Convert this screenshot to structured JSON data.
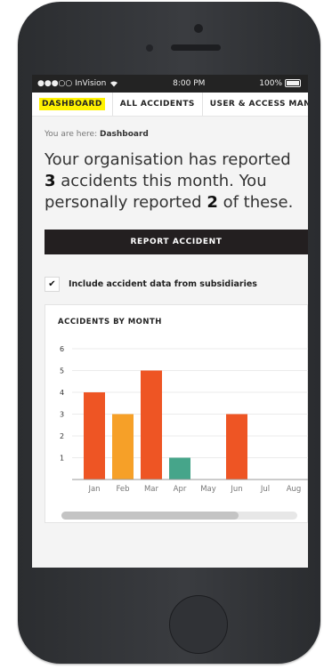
{
  "statusbar": {
    "carrier": "●●●○○ InVision",
    "wifi_icon": "wifi-icon",
    "time": "8:00 PM",
    "battery": "100%"
  },
  "nav": {
    "items": [
      {
        "label": "DASHBOARD",
        "active": true
      },
      {
        "label": "ALL ACCIDENTS",
        "active": false
      },
      {
        "label": "USER & ACCESS MANAG",
        "active": false
      }
    ]
  },
  "breadcrumb": {
    "prefix": "You are here:",
    "current": "Dashboard"
  },
  "headline": {
    "part1": "Your organisation has reported ",
    "count_org": "3",
    "part2": " accidents this month. You personally reported ",
    "count_user": "2",
    "part3": " of these."
  },
  "report_button": {
    "label": "REPORT ACCIDENT"
  },
  "subsidiaries": {
    "checked": true,
    "check_glyph": "✔",
    "label": "Include accident data from subsidiaries"
  },
  "chart_title": "ACCIDENTS BY MONTH",
  "chart_data": {
    "type": "bar",
    "title": "ACCIDENTS BY MONTH",
    "categories": [
      "Jan",
      "Feb",
      "Mar",
      "Apr",
      "May",
      "Jun",
      "Jul",
      "Aug"
    ],
    "values": [
      4,
      3,
      5,
      1,
      0,
      3,
      0,
      0
    ],
    "colors": [
      "#ee5524",
      "#f6a028",
      "#ee5524",
      "#46a58a",
      "#ee5524",
      "#ee5524",
      "#ee5524",
      "#ee5524"
    ],
    "yticks": [
      1,
      2,
      3,
      4,
      5,
      6
    ],
    "ylim": [
      0,
      6
    ],
    "grid": true
  },
  "scroll": {
    "position_fraction": 0.75
  }
}
